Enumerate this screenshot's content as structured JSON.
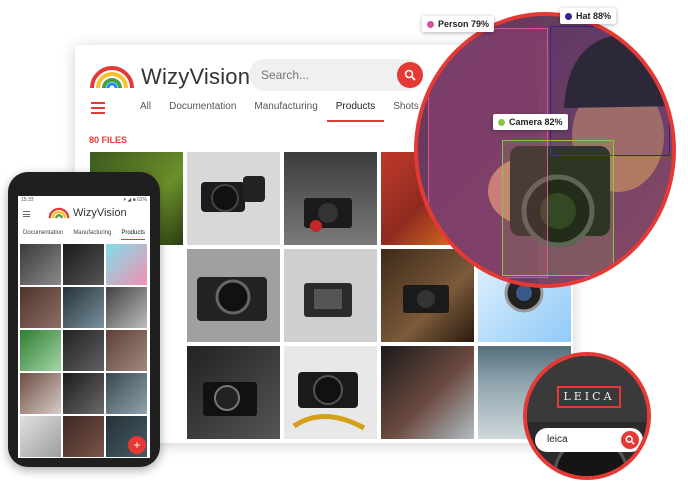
{
  "desktop": {
    "brand": "WizyVision",
    "search_placeholder": "Search...",
    "tabs": [
      {
        "label": "All",
        "active": false
      },
      {
        "label": "Documentation",
        "active": false
      },
      {
        "label": "Manufacturing",
        "active": false
      },
      {
        "label": "Products",
        "active": true
      },
      {
        "label": "Shots",
        "active": false
      }
    ],
    "files_count": "80 FILES"
  },
  "phone": {
    "status_time": "15:33",
    "status_right": "▾ ◢ ■ 62%",
    "brand": "WizyVision",
    "tabs": [
      {
        "label": "Documentation",
        "active": false
      },
      {
        "label": "Manufacturing",
        "active": false
      },
      {
        "label": "Products",
        "active": true
      }
    ],
    "fab_label": "+"
  },
  "detections": [
    {
      "label": "Person 79%",
      "color": "#d94f9a"
    },
    {
      "label": "Hat 88%",
      "color": "#3a1f8f"
    },
    {
      "label": "Camera 82%",
      "color": "#8bc34a"
    }
  ],
  "search_zoom": {
    "brand_text": "LEICA",
    "query": "leica"
  },
  "colors": {
    "accent": "#e53935"
  }
}
